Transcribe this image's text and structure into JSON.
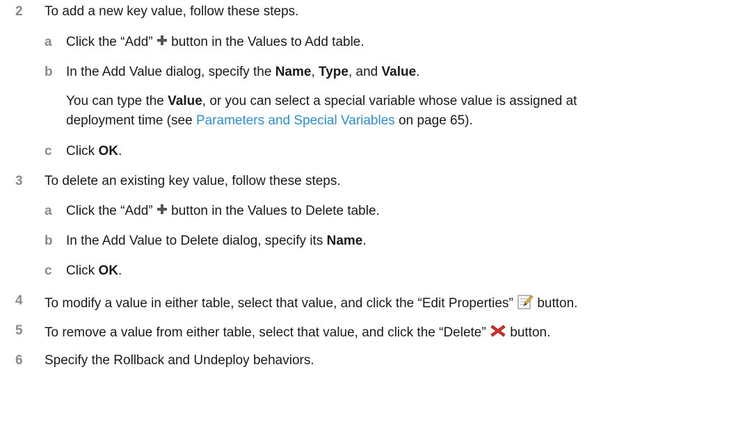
{
  "steps": [
    {
      "num": "2",
      "text": "To add a new key value, follow these steps."
    },
    {
      "num": "3",
      "text": "To delete an existing key value, follow these steps."
    },
    {
      "num": "4",
      "text_a": "To modify a value in either table, select that value, and click the “Edit Properties”",
      "text_b": "button."
    },
    {
      "num": "5",
      "text_a": "To remove a value from either table, select that value, and click the “Delete”",
      "text_b": "button."
    },
    {
      "num": "6",
      "text": "Specify the Rollback and Undeploy behaviors."
    }
  ],
  "s2a": {
    "letter": "a",
    "pre": "Click the “Add”",
    "post": "button in the Values to Add table."
  },
  "s2b": {
    "letter": "b",
    "pre": "In the Add Value dialog, specify the",
    "name": "Name",
    "c1": ",",
    "type": "Type",
    "c2": ", and",
    "value": "Value",
    "end": "."
  },
  "s2b_note": {
    "l1_pre": "You can type the",
    "l1_value": "Value",
    "l1_post": ", or you can select a special variable whose value is assigned at",
    "l2_pre": "deployment time (see",
    "link": "Parameters and Special Variables",
    "l2_post": "on page 65)."
  },
  "s2c": {
    "letter": "c",
    "pre": "Click",
    "ok": "OK",
    "end": "."
  },
  "s3a": {
    "letter": "a",
    "pre": "Click the “Add”",
    "post": "button in the Values to Delete table."
  },
  "s3b": {
    "letter": "b",
    "pre": "In the Add Value to Delete dialog, specify its",
    "name": "Name",
    "end": "."
  },
  "s3c": {
    "letter": "c",
    "pre": "Click",
    "ok": "OK",
    "end": "."
  },
  "icons": {
    "add": "plus-icon",
    "edit": "edit-properties-icon",
    "delete": "delete-x-icon"
  },
  "colors": {
    "link": "#2a8fd6",
    "step_number": "#8a8a8a",
    "add_icon": "#555555",
    "delete_icon": "#d9302a"
  }
}
